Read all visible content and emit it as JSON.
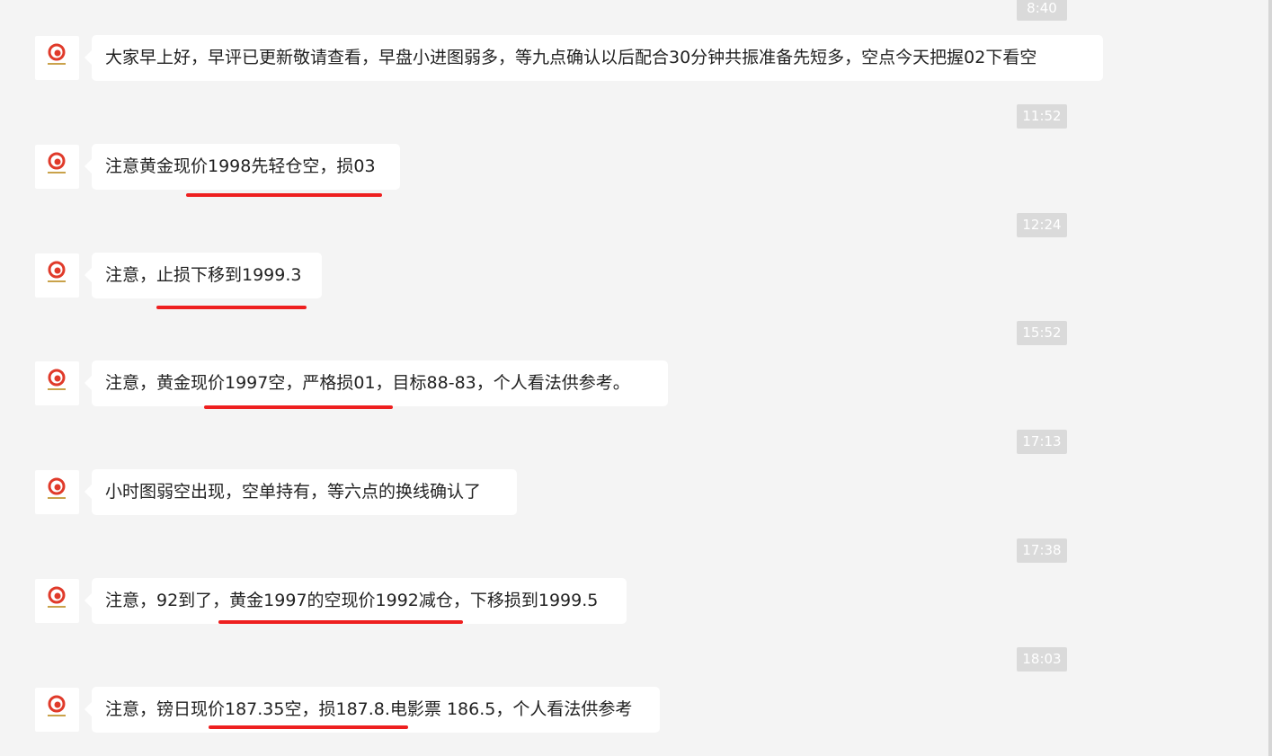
{
  "messages": [
    {
      "time": "8:40",
      "text": "大家早上好，早评已更新敬请查看，早盘小进图弱多，等九点确认以后配合30分钟共振准备先短多，空点今天把握02下看空"
    },
    {
      "time": "11:52",
      "text": "注意黄金现价1998先轻仓空，损03"
    },
    {
      "time": "12:24",
      "text": "注意，止损下移到1999.3"
    },
    {
      "time": "15:52",
      "text": "注意，黄金现价1997空，严格损01，目标88-83，个人看法供参考。"
    },
    {
      "time": "17:13",
      "text": "小时图弱空出现，空单持有，等六点的换线确认了"
    },
    {
      "time": "17:38",
      "text": "注意，92到了，黄金1997的空现价1992减仓，下移损到1999.5"
    },
    {
      "time": "18:03",
      "text": "注意，镑日现价187.35空，损187.8.电影票 186.5，个人看法供参考"
    }
  ],
  "colors": {
    "background": "#f4f4f4",
    "bubble": "#ffffff",
    "timestamp_bg": "#dadada",
    "underline": "#ee1f1f",
    "avatar_logo": "#e03a2a"
  },
  "icons": {
    "avatar": "red-swirl-logo-icon"
  }
}
